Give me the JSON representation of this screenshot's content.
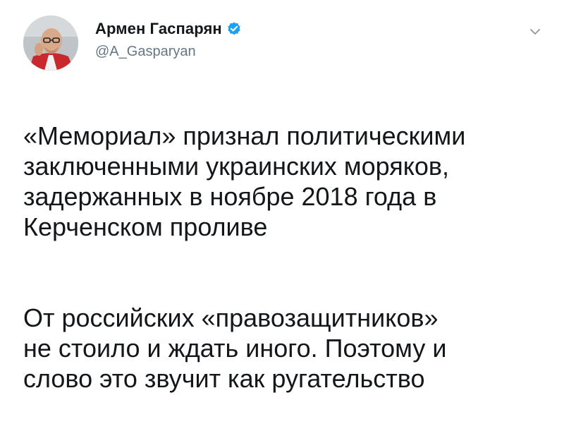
{
  "tweet": {
    "author": {
      "display_name": "Армен Гаспарян",
      "handle": "@A_Gasparyan",
      "verified": true,
      "avatar_icon": "avatar-photo"
    },
    "menu_icon": "chevron-down-icon",
    "body": {
      "paragraph_1": "«Мемориал» признал политическими\nзаключенными украинских моряков,\nзадержанных в ноябре 2018 года в\nКерченском проливе",
      "paragraph_2": "От российских «правозащитников»\nне стоило и ждать иного. Поэтому и\nслово это звучит как ругательство"
    }
  },
  "colors": {
    "text": "#14171a",
    "secondary_text": "#657786",
    "verified_blue": "#1da1f2"
  }
}
